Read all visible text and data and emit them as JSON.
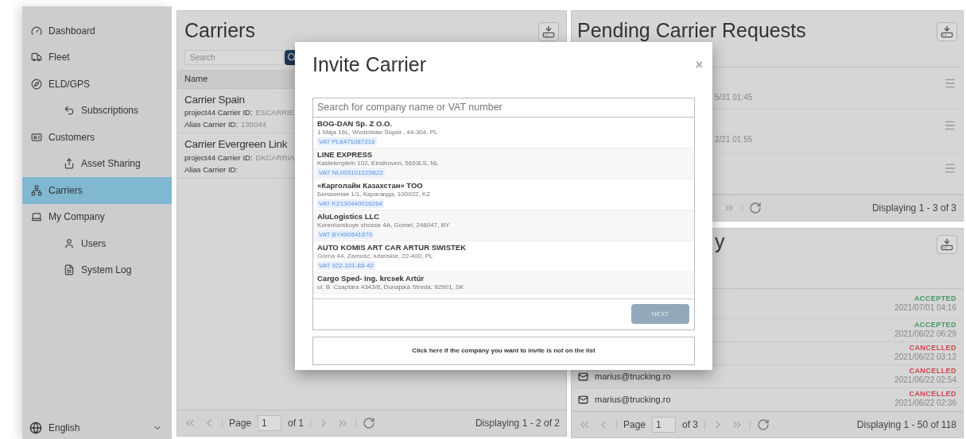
{
  "sidebar": {
    "items": [
      {
        "label": "Dashboard",
        "selected": false
      },
      {
        "label": "Fleet",
        "selected": false
      },
      {
        "label": "ELD/GPS",
        "selected": false,
        "children": [
          {
            "label": "Subscriptions",
            "selected": false
          }
        ]
      },
      {
        "label": "Customers",
        "selected": false,
        "children": [
          {
            "label": "Asset Sharing",
            "selected": false
          }
        ]
      },
      {
        "label": "Carriers",
        "selected": true
      },
      {
        "label": "My Company",
        "selected": false,
        "children": [
          {
            "label": "Users",
            "selected": false
          },
          {
            "label": "System Log",
            "selected": false
          }
        ]
      }
    ],
    "language": "English"
  },
  "carriers": {
    "title": "Carriers",
    "search": {
      "placeholder": "Search"
    },
    "column": "Name",
    "rows": [
      {
        "name": "Carrier Spain",
        "id_label": "project44 Carrier ID:",
        "id_value": "ESCARRIE",
        "alias_label": "Alias Carrier ID:",
        "alias_value": "130044"
      },
      {
        "name": "Carrier Evergreen Link",
        "id_label": "project44 Carrier ID:",
        "id_value": "DKCARRIA",
        "alias_label": "Alias Carrier ID:"
      }
    ],
    "pager": {
      "page_label": "Page",
      "page": "1",
      "of": "of 1",
      "display": "Displaying 1 - 2 of 2"
    }
  },
  "pending": {
    "title": "Pending Carrier Requests",
    "rows": [
      {
        "kind": "request",
        "time": "5/31 01:45"
      },
      {
        "kind": "request",
        "time": "2/21 01:55"
      },
      {
        "kind": "request"
      }
    ],
    "pager": {
      "display": "Displaying 1 - 3 of 3"
    }
  },
  "history": {
    "title": "y",
    "rows": [
      {
        "status": "ACCEPTED",
        "color": "#3f9a5e",
        "time": "2021/07/01 04:16"
      },
      {
        "status": "ACCEPTED",
        "color": "#3f9a5e",
        "time": "2021/06/22 06:29"
      },
      {
        "status": "CANCELLED",
        "color": "#c9474c",
        "time": "2021/06/22 03:12"
      },
      {
        "email": "marius@trucking.ro",
        "status": "CANCELLED",
        "color": "#c9474c",
        "time": "2021/06/22 02:54"
      },
      {
        "email": "marius@trucking.ro",
        "status": "CANCELLED",
        "color": "#c9474c",
        "time": "2021/06/22 02:36"
      }
    ],
    "pager": {
      "page_label": "Page",
      "page": "1",
      "of": "of 3",
      "display": "Displaying 1 - 50 of 118"
    }
  },
  "modal": {
    "title": "Invite Carrier",
    "close": "×",
    "search": {
      "placeholder": "Search for company name or VAT number"
    },
    "results": [
      {
        "name": "BOG-DAN Sp. Z O.O.",
        "address": "1 Maja 16L, Wodzisław Śląski , 44-304, PL",
        "vat": "VAT PL6471087216"
      },
      {
        "name": "LINE EXPRESS",
        "address": "Kastelenplein 102, Eindhoven, 5653LS, NL",
        "vat": "VAT NL003101225B22"
      },
      {
        "name": "«Карголайн Казахстан» ТОО",
        "address": "Бензинная 1/1, Караганда, 100022, KZ",
        "vat": "VAT KZ130440016264"
      },
      {
        "name": "AluLogistics LLC",
        "address": "Koreniovskoye shosse 4A, Gomel, 246047, BY",
        "vat": "VAT BY490541870"
      },
      {
        "name": "AUTO KOMIS ART CAR ARTUR SWISTEK",
        "address": "Górna 44, Zamość, lubelskie, 22-400, PL",
        "vat": "VAT 922-101-88-42"
      },
      {
        "name": "Cargo Sped- Ing. krcsek Artúr",
        "address": "ul. B. Csaplára 4343/8, Dunajská Streda, 92901, SK"
      }
    ],
    "next": {
      "label": "NEXT",
      "disabled": true
    },
    "not_listed": "Click here if the company you want to invite is not on the list"
  }
}
